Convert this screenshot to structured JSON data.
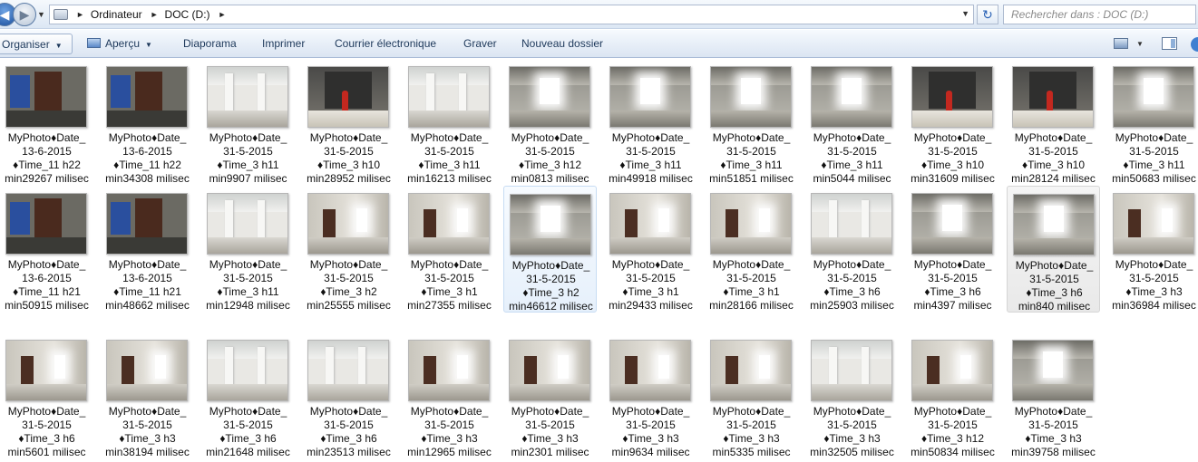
{
  "address": {
    "crumbs": [
      "Ordinateur",
      "DOC (D:)"
    ],
    "search_placeholder": "Rechercher dans : DOC (D:)"
  },
  "toolbar": {
    "organiser": "Organiser",
    "apercu": "Aperçu",
    "diaporama": "Diaporama",
    "imprimer": "Imprimer",
    "courrier": "Courrier électronique",
    "graver": "Graver",
    "nouveau_dossier": "Nouveau dossier"
  },
  "files": [
    {
      "l1": "MyPhoto♦Date_",
      "l2": "13-6-2015",
      "l3": "♦Time_11 h22",
      "l4": "min29267 milisec",
      "scene": "office"
    },
    {
      "l1": "MyPhoto♦Date_",
      "l2": "13-6-2015",
      "l3": "♦Time_11 h22",
      "l4": "min34308 milisec",
      "scene": "office"
    },
    {
      "l1": "MyPhoto♦Date_",
      "l2": "31-5-2015",
      "l3": "♦Time_3 h11",
      "l4": "min9907 milisec",
      "scene": "hall"
    },
    {
      "l1": "MyPhoto♦Date_",
      "l2": "31-5-2015",
      "l3": "♦Time_3 h10",
      "l4": "min28952 milisec",
      "scene": "entrance"
    },
    {
      "l1": "MyPhoto♦Date_",
      "l2": "31-5-2015",
      "l3": "♦Time_3 h11",
      "l4": "min16213 milisec",
      "scene": "hall"
    },
    {
      "l1": "MyPhoto♦Date_",
      "l2": "31-5-2015",
      "l3": "♦Time_3 h12",
      "l4": "min0813 milisec",
      "scene": "bright"
    },
    {
      "l1": "MyPhoto♦Date_",
      "l2": "31-5-2015",
      "l3": "♦Time_3 h11",
      "l4": "min49918 milisec",
      "scene": "bright"
    },
    {
      "l1": "MyPhoto♦Date_",
      "l2": "31-5-2015",
      "l3": "♦Time_3 h11",
      "l4": "min51851 milisec",
      "scene": "bright"
    },
    {
      "l1": "MyPhoto♦Date_",
      "l2": "31-5-2015",
      "l3": "♦Time_3 h11",
      "l4": "min5044 milisec",
      "scene": "bright"
    },
    {
      "l1": "MyPhoto♦Date_",
      "l2": "31-5-2015",
      "l3": "♦Time_3 h10",
      "l4": "min31609 milisec",
      "scene": "entrance"
    },
    {
      "l1": "MyPhoto♦Date_",
      "l2": "31-5-2015",
      "l3": "♦Time_3 h10",
      "l4": "min28124 milisec",
      "scene": "entrance"
    },
    {
      "l1": "MyPhoto♦Date_",
      "l2": "31-5-2015",
      "l3": "♦Time_3 h11",
      "l4": "min50683 milisec",
      "scene": "bright"
    },
    {
      "l1": "MyPhoto♦Date_",
      "l2": "13-6-2015",
      "l3": "♦Time_11 h21",
      "l4": "min50915 milisec",
      "scene": "office"
    },
    {
      "l1": "MyPhoto♦Date_",
      "l2": "13-6-2015",
      "l3": "♦Time_11 h21",
      "l4": "min48662 milisec",
      "scene": "office"
    },
    {
      "l1": "MyPhoto♦Date_",
      "l2": "31-5-2015",
      "l3": "♦Time_3 h11",
      "l4": "min12948 milisec",
      "scene": "hall"
    },
    {
      "l1": "MyPhoto♦Date_",
      "l2": "31-5-2015",
      "l3": "♦Time_3 h2",
      "l4": "min25555 milisec",
      "scene": "corridor"
    },
    {
      "l1": "MyPhoto♦Date_",
      "l2": "31-5-2015",
      "l3": "♦Time_3 h1",
      "l4": "min27355 milisec",
      "scene": "corridor"
    },
    {
      "l1": "MyPhoto♦Date_",
      "l2": "31-5-2015",
      "l3": "♦Time_3 h2",
      "l4": "min46612 milisec",
      "scene": "bright",
      "state": "sel"
    },
    {
      "l1": "MyPhoto♦Date_",
      "l2": "31-5-2015",
      "l3": "♦Time_3 h1",
      "l4": "min29433 milisec",
      "scene": "corridor"
    },
    {
      "l1": "MyPhoto♦Date_",
      "l2": "31-5-2015",
      "l3": "♦Time_3 h1",
      "l4": "min28166 milisec",
      "scene": "corridor"
    },
    {
      "l1": "MyPhoto♦Date_",
      "l2": "31-5-2015",
      "l3": "♦Time_3 h6",
      "l4": "min25903 milisec",
      "scene": "hall"
    },
    {
      "l1": "MyPhoto♦Date_",
      "l2": "31-5-2015",
      "l3": "♦Time_3 h6",
      "l4": "min4397 milisec",
      "scene": "bright"
    },
    {
      "l1": "MyPhoto♦Date_",
      "l2": "31-5-2015",
      "l3": "♦Time_3 h6",
      "l4": "min840 milisec",
      "scene": "bright",
      "state": "hov"
    },
    {
      "l1": "MyPhoto♦Date_",
      "l2": "31-5-2015",
      "l3": "♦Time_3 h3",
      "l4": "min36984 milisec",
      "scene": "corridor"
    },
    {
      "l1": "MyPhoto♦Date_",
      "l2": "31-5-2015",
      "l3": "♦Time_3 h6",
      "l4": "min5601 milisec",
      "scene": "corridor"
    },
    {
      "l1": "MyPhoto♦Date_",
      "l2": "31-5-2015",
      "l3": "♦Time_3 h3",
      "l4": "min38194 milisec",
      "scene": "corridor"
    },
    {
      "l1": "MyPhoto♦Date_",
      "l2": "31-5-2015",
      "l3": "♦Time_3 h6",
      "l4": "min21648 milisec",
      "scene": "hall"
    },
    {
      "l1": "MyPhoto♦Date_",
      "l2": "31-5-2015",
      "l3": "♦Time_3 h6",
      "l4": "min23513 milisec",
      "scene": "hall"
    },
    {
      "l1": "MyPhoto♦Date_",
      "l2": "31-5-2015",
      "l3": "♦Time_3 h3",
      "l4": "min12965 milisec",
      "scene": "corridor"
    },
    {
      "l1": "MyPhoto♦Date_",
      "l2": "31-5-2015",
      "l3": "♦Time_3 h3",
      "l4": "min2301 milisec",
      "scene": "corridor"
    },
    {
      "l1": "MyPhoto♦Date_",
      "l2": "31-5-2015",
      "l3": "♦Time_3 h3",
      "l4": "min9634 milisec",
      "scene": "corridor"
    },
    {
      "l1": "MyPhoto♦Date_",
      "l2": "31-5-2015",
      "l3": "♦Time_3 h3",
      "l4": "min5335 milisec",
      "scene": "corridor"
    },
    {
      "l1": "MyPhoto♦Date_",
      "l2": "31-5-2015",
      "l3": "♦Time_3 h3",
      "l4": "min32505 milisec",
      "scene": "hall"
    },
    {
      "l1": "MyPhoto♦Date_",
      "l2": "31-5-2015",
      "l3": "♦Time_3 h12",
      "l4": "min50834 milisec",
      "scene": "corridor"
    },
    {
      "l1": "MyPhoto♦Date_",
      "l2": "31-5-2015",
      "l3": "♦Time_3 h3",
      "l4": "min39758 milisec",
      "scene": "bright"
    }
  ]
}
